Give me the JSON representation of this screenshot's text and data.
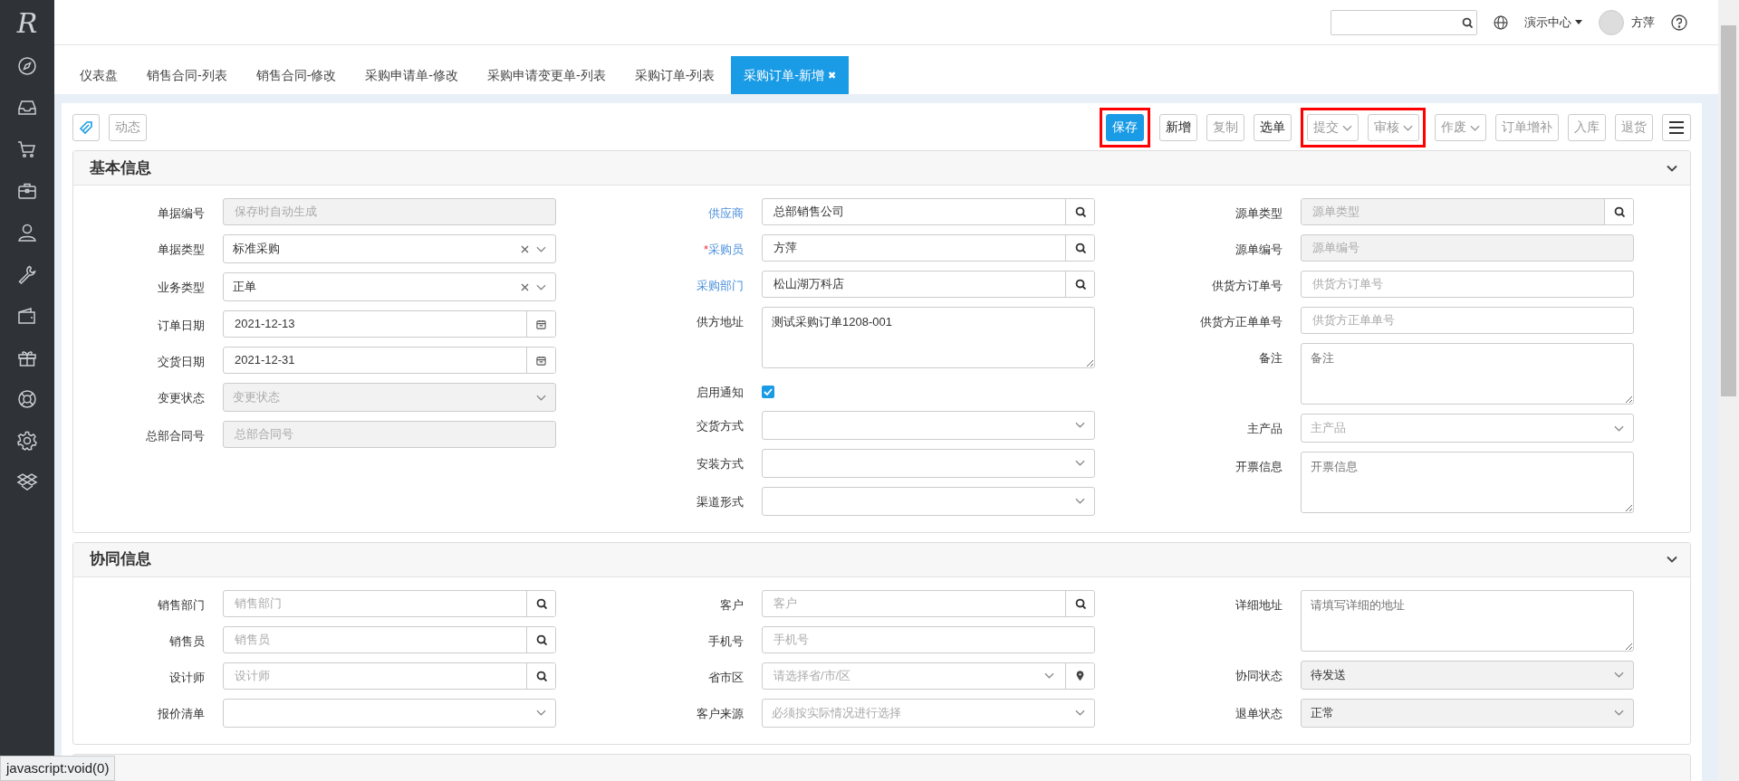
{
  "sidebar": {
    "logo": "R"
  },
  "topbar": {
    "org_menu": "演示中心",
    "user": "方萍"
  },
  "tabs": [
    {
      "label": "仪表盘",
      "selected": false
    },
    {
      "label": "销售合同-列表",
      "selected": false
    },
    {
      "label": "销售合同-修改",
      "selected": false
    },
    {
      "label": "采购申请单-修改",
      "selected": false
    },
    {
      "label": "采购申请变更单-列表",
      "selected": false
    },
    {
      "label": "采购订单-列表",
      "selected": false
    },
    {
      "label": "采购订单-新增",
      "selected": true,
      "close": "✖"
    }
  ],
  "toolbar": {
    "left": [
      {
        "label": "动态"
      }
    ],
    "right": [
      {
        "label": "保存",
        "kind": "primary",
        "disabled": false,
        "dropdown": false,
        "highlighted": true
      },
      {
        "label": "新增",
        "kind": "default",
        "disabled": false,
        "dropdown": false,
        "highlighted": false
      },
      {
        "label": "复制",
        "kind": "default",
        "disabled": true,
        "dropdown": false,
        "highlighted": false
      },
      {
        "label": "选单",
        "kind": "default",
        "disabled": false,
        "dropdown": false,
        "highlighted": false
      },
      {
        "label": "提交",
        "kind": "default",
        "disabled": true,
        "dropdown": true,
        "highlighted": true
      },
      {
        "label": "审核",
        "kind": "default",
        "disabled": true,
        "dropdown": true,
        "highlighted": true
      },
      {
        "label": "作废",
        "kind": "default",
        "disabled": true,
        "dropdown": true,
        "highlighted": false
      },
      {
        "label": "订单增补",
        "kind": "default",
        "disabled": true,
        "dropdown": false,
        "highlighted": false
      },
      {
        "label": "入库",
        "kind": "default",
        "disabled": true,
        "dropdown": false,
        "highlighted": false
      },
      {
        "label": "退货",
        "kind": "default",
        "disabled": true,
        "dropdown": false,
        "highlighted": false
      }
    ]
  },
  "sections": [
    {
      "title": "基本信息",
      "expanded": true,
      "columns": [
        [
          {
            "label": "单据编号",
            "label_link": false,
            "kind": "text",
            "placeholder": "保存时自动生成",
            "disabled": true
          },
          {
            "label": "单据类型",
            "label_link": false,
            "kind": "select",
            "value": "标准采购",
            "clearable": true,
            "disabled": false
          },
          {
            "label": "业务类型",
            "label_link": false,
            "kind": "select",
            "value": "正单",
            "clearable": true,
            "disabled": false
          },
          {
            "label": "订单日期",
            "label_link": false,
            "kind": "date",
            "value": "2021-12-13",
            "disabled": false
          },
          {
            "label": "交货日期",
            "label_link": false,
            "kind": "date",
            "value": "2021-12-31",
            "disabled": false
          },
          {
            "label": "变更状态",
            "label_link": false,
            "kind": "select",
            "placeholder": "变更状态",
            "clearable": false,
            "disabled": true
          },
          {
            "label": "总部合同号",
            "label_link": false,
            "kind": "text",
            "placeholder": "总部合同号",
            "disabled": true
          }
        ],
        [
          {
            "label": "供应商",
            "label_link": true,
            "kind": "lookup",
            "value": "总部销售公司",
            "disabled": false
          },
          {
            "label": "采购员",
            "label_link": true,
            "required_mark": "*",
            "kind": "lookup",
            "value": "方萍",
            "disabled": false
          },
          {
            "label": "采购部门",
            "label_link": true,
            "kind": "lookup",
            "value": "松山湖万科店",
            "disabled": false
          },
          {
            "label": "供方地址",
            "label_link": false,
            "kind": "textarea",
            "value": "测试采购订单1208-001",
            "disabled": false
          },
          {
            "label": "启用通知",
            "label_link": false,
            "kind": "checkbox",
            "checked": true
          },
          {
            "label": "交货方式",
            "label_link": false,
            "kind": "select",
            "clearable": false,
            "disabled": false
          },
          {
            "label": "安装方式",
            "label_link": false,
            "kind": "select",
            "clearable": false,
            "disabled": false
          },
          {
            "label": "渠道形式",
            "label_link": false,
            "kind": "select",
            "clearable": false,
            "disabled": false
          }
        ],
        [
          {
            "label": "源单类型",
            "label_link": false,
            "kind": "lookup",
            "placeholder": "源单类型",
            "disabled": true
          },
          {
            "label": "源单编号",
            "label_link": false,
            "kind": "text",
            "placeholder": "源单编号",
            "disabled": true
          },
          {
            "label": "供货方订单号",
            "label_link": false,
            "kind": "text",
            "placeholder": "供货方订单号",
            "disabled": false
          },
          {
            "label": "供货方正单单号",
            "label_link": false,
            "kind": "text",
            "placeholder": "供货方正单单号",
            "disabled": false
          },
          {
            "label": "备注",
            "label_link": false,
            "kind": "textarea",
            "placeholder": "备注",
            "disabled": false
          },
          {
            "label": "主产品",
            "label_link": false,
            "kind": "select",
            "placeholder": "主产品",
            "clearable": false,
            "disabled": false
          },
          {
            "label": "开票信息",
            "label_link": false,
            "kind": "textarea",
            "placeholder": "开票信息",
            "disabled": false
          }
        ]
      ]
    },
    {
      "title": "协同信息",
      "expanded": true,
      "columns": [
        [
          {
            "label": "销售部门",
            "label_link": false,
            "kind": "lookup",
            "placeholder": "销售部门",
            "disabled": false
          },
          {
            "label": "销售员",
            "label_link": false,
            "kind": "lookup",
            "placeholder": "销售员",
            "disabled": false
          },
          {
            "label": "设计师",
            "label_link": false,
            "kind": "lookup",
            "placeholder": "设计师",
            "disabled": false
          },
          {
            "label": "报价清单",
            "label_link": false,
            "kind": "select",
            "clearable": false,
            "disabled": false
          }
        ],
        [
          {
            "label": "客户",
            "label_link": false,
            "kind": "lookup",
            "placeholder": "客户",
            "disabled": false
          },
          {
            "label": "手机号",
            "label_link": false,
            "kind": "text",
            "placeholder": "手机号",
            "disabled": false
          },
          {
            "label": "省市区",
            "label_link": false,
            "kind": "region",
            "placeholder": "请选择省/市/区",
            "disabled": false
          },
          {
            "label": "客户来源",
            "label_link": false,
            "kind": "select",
            "placeholder": "必须按实际情况进行选择",
            "clearable": false,
            "disabled": false
          }
        ],
        [
          {
            "label": "详细地址",
            "label_link": false,
            "kind": "textarea",
            "placeholder": "请填写详细的地址",
            "disabled": false
          },
          {
            "label": "协同状态",
            "label_link": false,
            "kind": "select",
            "value": "待发送",
            "clearable": false,
            "disabled": true
          },
          {
            "label": "退单状态",
            "label_link": false,
            "kind": "select",
            "value": "正常",
            "clearable": false,
            "disabled": true
          }
        ]
      ]
    }
  ],
  "status_bar": "javascript:void(0)"
}
